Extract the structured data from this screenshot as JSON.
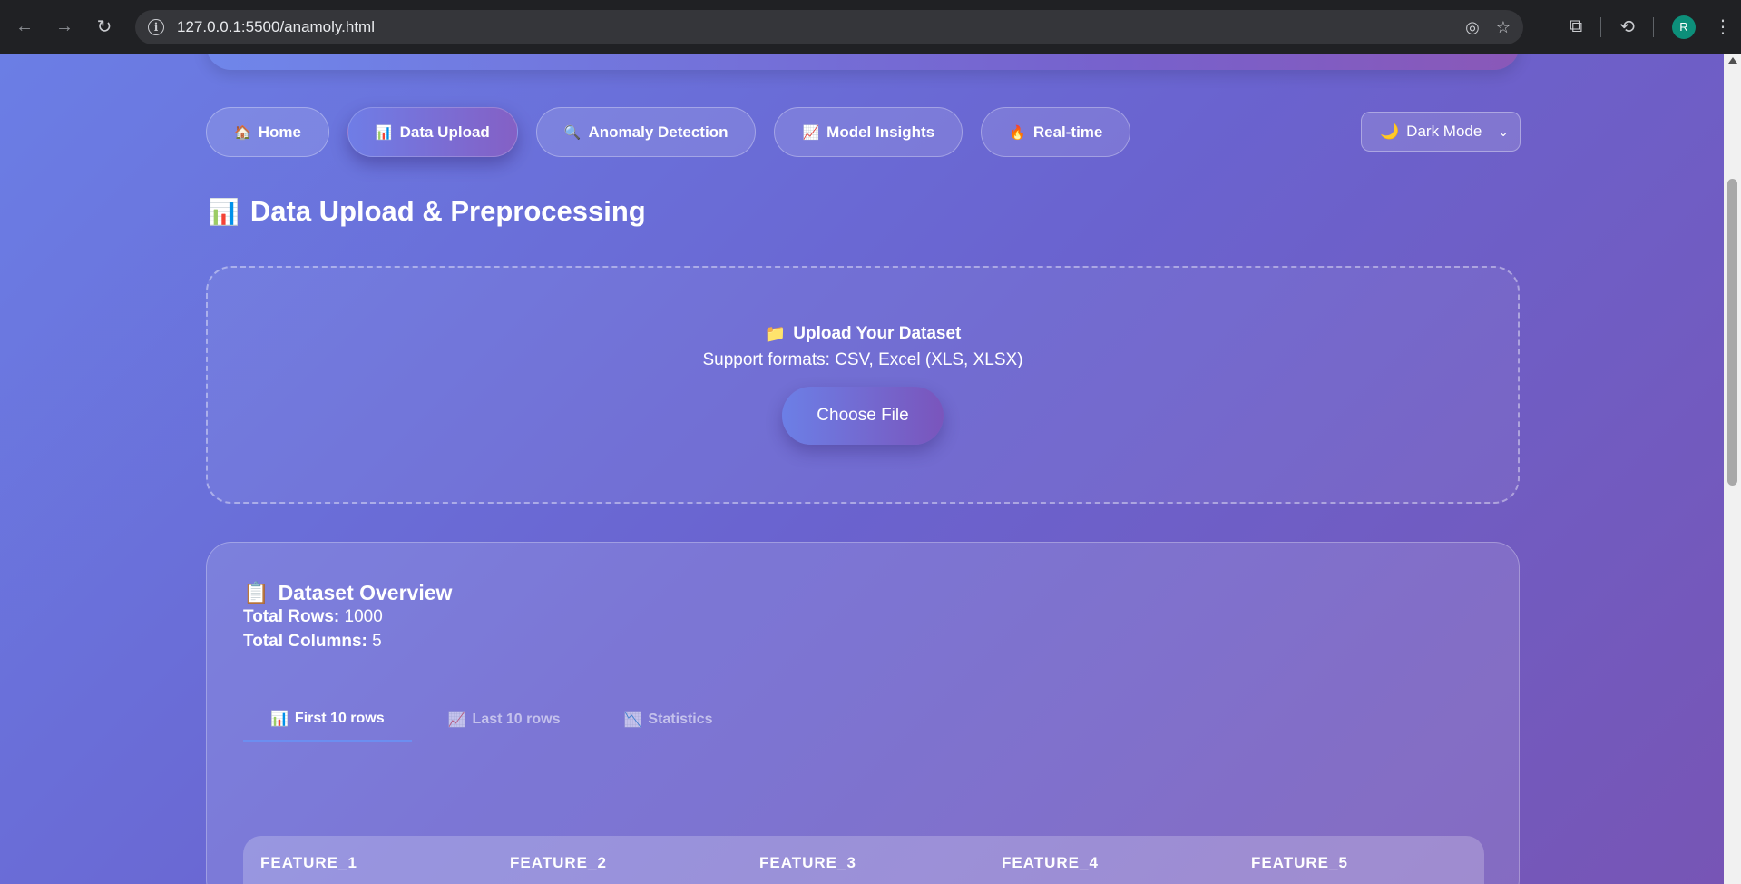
{
  "browser": {
    "url": "127.0.0.1:5500/anamoly.html",
    "profile_initial": "R"
  },
  "nav": {
    "items": [
      {
        "icon": "🏠",
        "label": "Home"
      },
      {
        "icon": "📊",
        "label": "Data Upload"
      },
      {
        "icon": "🔍",
        "label": "Anomaly Detection"
      },
      {
        "icon": "📈",
        "label": "Model Insights"
      },
      {
        "icon": "🔥",
        "label": "Real-time"
      }
    ],
    "active": "Data Upload",
    "theme_select": {
      "icon": "🌙",
      "value": "Dark Mode"
    }
  },
  "page": {
    "title_icon": "📊",
    "title": "Data Upload & Preprocessing"
  },
  "upload": {
    "icon": "📁",
    "title": "Upload Your Dataset",
    "subtitle": "Support formats: CSV, Excel (XLS, XLSX)",
    "button_label": "Choose File"
  },
  "overview": {
    "icon": "📋",
    "title": "Dataset Overview",
    "rows_label": "Total Rows:",
    "rows_value": "1000",
    "cols_label": "Total Columns:",
    "cols_value": "5",
    "tabs": [
      {
        "icon": "📊",
        "label": "First 10 rows"
      },
      {
        "icon": "📈",
        "label": "Last 10 rows"
      },
      {
        "icon": "📉",
        "label": "Statistics"
      }
    ],
    "columns": [
      "FEATURE_1",
      "FEATURE_2",
      "FEATURE_3",
      "FEATURE_4",
      "FEATURE_5"
    ]
  },
  "colors": {
    "chrome_bg": "#202124",
    "page_gradient_start": "#6b7ee5",
    "page_gradient_end": "#7755b5",
    "tab_underline": "#6c8ef0"
  }
}
